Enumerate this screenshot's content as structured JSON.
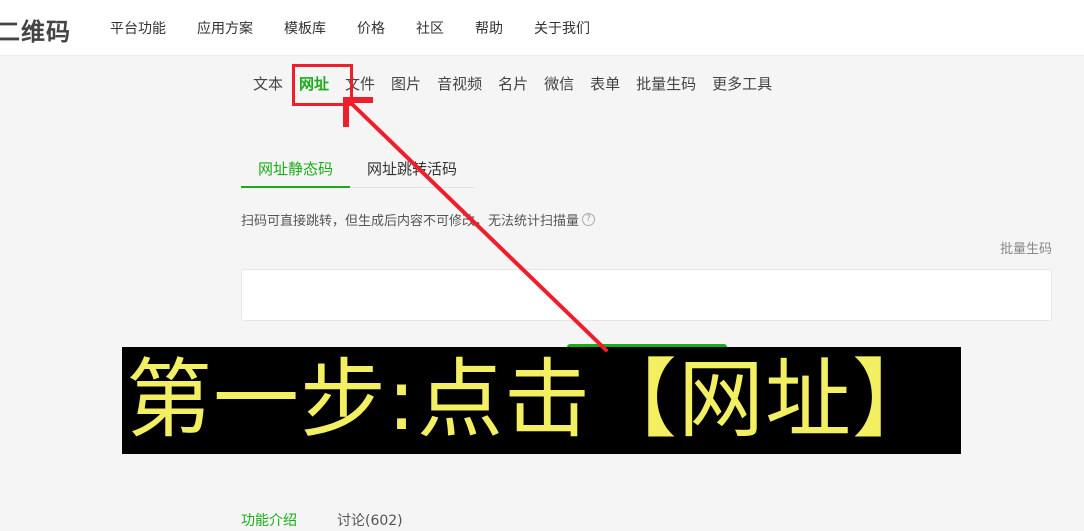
{
  "header": {
    "logo_text": "二维码",
    "nav": [
      "平台功能",
      "应用方案",
      "模板库",
      "价格",
      "社区",
      "帮助",
      "关于我们"
    ]
  },
  "categories": {
    "items": [
      "文本",
      "网址",
      "文件",
      "图片",
      "音视频",
      "名片",
      "微信",
      "表单",
      "批量生码",
      "更多工具"
    ],
    "active": "网址"
  },
  "subtabs": {
    "items": [
      "网址静态码",
      "网址跳转活码"
    ],
    "active": "网址静态码"
  },
  "description": "扫码可直接跳转，但生成后内容不可修改，无法统计扫描量",
  "help_icon": "question-circle-icon",
  "batch_link": "批量生码",
  "url_input": {
    "value": "",
    "placeholder": ""
  },
  "annotation": {
    "banner_text": "第一步:点击【网址】",
    "banner_text_color": "#f3ef62",
    "arrow_color": "#ee1f2a"
  },
  "bottom_tabs": {
    "items": [
      "功能介绍",
      "讨论(602)"
    ],
    "active": "功能介绍"
  },
  "colors": {
    "accent": "#1aad19",
    "annotation_red": "#ee1f2a",
    "banner_bg": "#000000"
  }
}
